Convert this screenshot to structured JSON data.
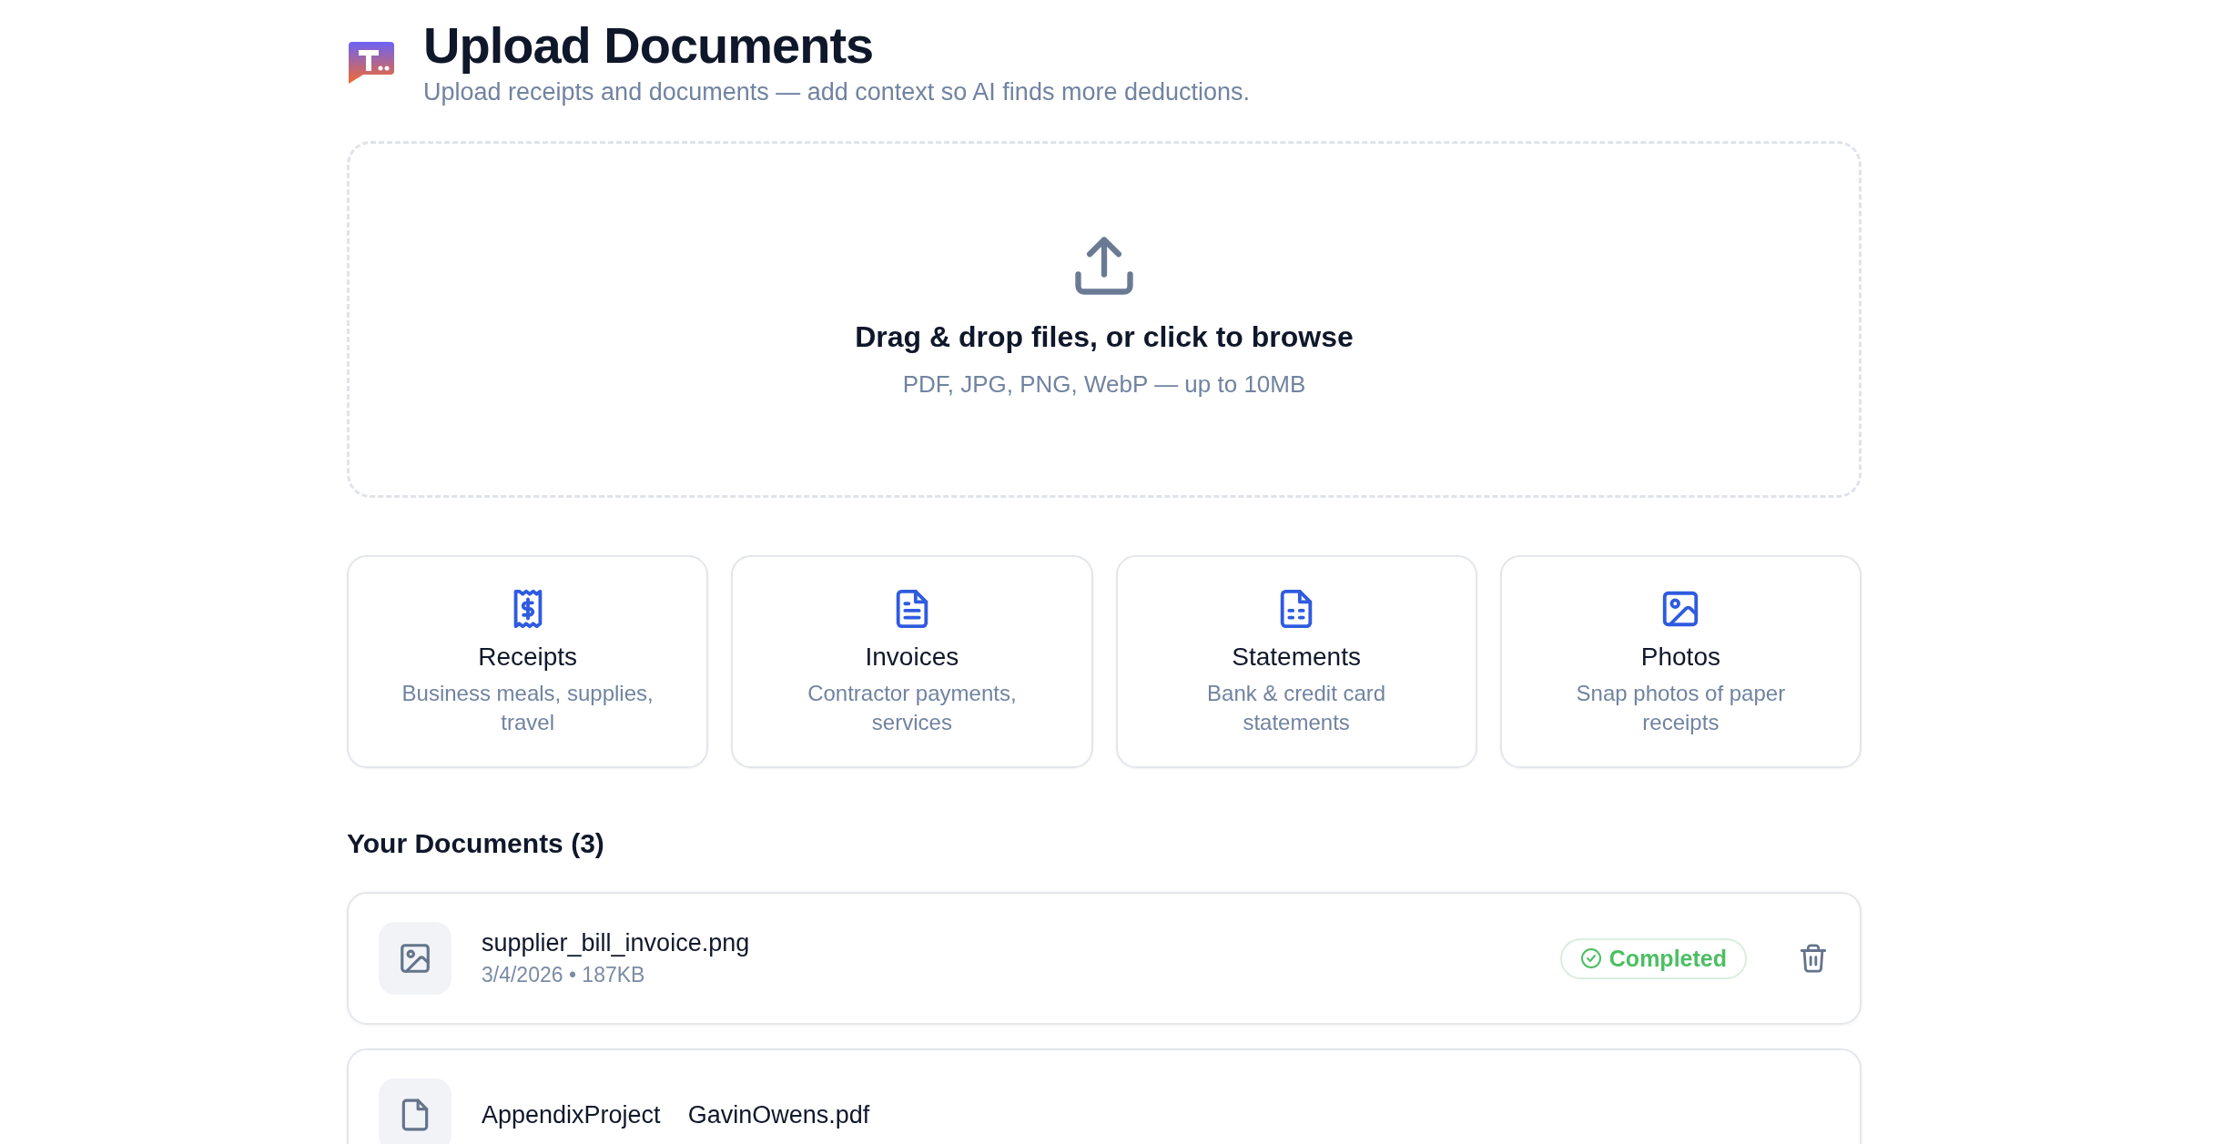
{
  "header": {
    "title": "Upload Documents",
    "subtitle": "Upload receipts and documents — add context so AI finds more deductions."
  },
  "dropzone": {
    "title": "Drag & drop files, or click to browse",
    "hint": "PDF, JPG, PNG, WebP — up to 10MB"
  },
  "categories": [
    {
      "kind": "receipt",
      "title": "Receipts",
      "description": "Business meals, supplies, travel"
    },
    {
      "kind": "invoice",
      "title": "Invoices",
      "description": "Contractor payments, services"
    },
    {
      "kind": "statement",
      "title": "Statements",
      "description": "Bank & credit card statements"
    },
    {
      "kind": "photo",
      "title": "Photos",
      "description": "Snap photos of paper receipts"
    }
  ],
  "documents": {
    "heading": "Your Documents (3)",
    "items": [
      {
        "kind": "image",
        "name": "supplier_bill_invoice.png",
        "meta": "3/4/2026 • 187KB",
        "status": "Completed"
      },
      {
        "kind": "pdf",
        "name": "AppendixProject    GavinOwens.pdf"
      }
    ]
  }
}
